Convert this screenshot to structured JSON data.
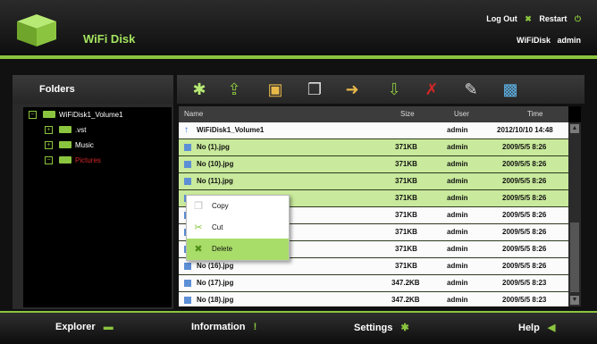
{
  "header": {
    "title": "WiFi Disk",
    "logout_label": "Log Out",
    "restart_label": "Restart",
    "device_name": "WiFiDisk",
    "user": "admin"
  },
  "folders": {
    "title": "Folders",
    "tree": [
      {
        "label": "WiFiDisk1_Volume1",
        "expander": "−"
      },
      {
        "label": ".vst",
        "expander": "+"
      },
      {
        "label": "Music",
        "expander": "+"
      },
      {
        "label": "Pictures",
        "expander": "−"
      }
    ]
  },
  "toolbar": {
    "icons": [
      "gear-icon",
      "upload-icon",
      "new-folder-icon",
      "copy-icon",
      "move-icon",
      "download-icon",
      "delete-icon",
      "rename-icon",
      "image-view-icon"
    ]
  },
  "table": {
    "headers": {
      "name": "Name",
      "size": "Size",
      "user": "User",
      "time": "Time"
    },
    "rows": [
      {
        "name": "WiFiDisk1_Volume1",
        "size": "",
        "user": "admin",
        "time": "2012/10/10 14:48"
      },
      {
        "name": "No (1).jpg",
        "size": "371KB",
        "user": "admin",
        "time": "2009/5/5 8:26"
      },
      {
        "name": "No (10).jpg",
        "size": "371KB",
        "user": "admin",
        "time": "2009/5/5 8:26"
      },
      {
        "name": "No (11).jpg",
        "size": "371KB",
        "user": "admin",
        "time": "2009/5/5 8:26"
      },
      {
        "name": "",
        "size": "371KB",
        "user": "admin",
        "time": "2009/5/5 8:26"
      },
      {
        "name": "",
        "size": "371KB",
        "user": "admin",
        "time": "2009/5/5 8:26"
      },
      {
        "name": "",
        "size": "371KB",
        "user": "admin",
        "time": "2009/5/5 8:26"
      },
      {
        "name": "",
        "size": "371KB",
        "user": "admin",
        "time": "2009/5/5 8:26"
      },
      {
        "name": "No (16).jpg",
        "size": "371KB",
        "user": "admin",
        "time": "2009/5/5 8:26"
      },
      {
        "name": "No (17).jpg",
        "size": "347.2KB",
        "user": "admin",
        "time": "2009/5/5 8:23"
      },
      {
        "name": "No (18).jpg",
        "size": "347.2KB",
        "user": "admin",
        "time": "2009/5/5 8:23"
      }
    ]
  },
  "context_menu": {
    "items": [
      {
        "label": "Copy"
      },
      {
        "label": "Cut"
      },
      {
        "label": "Delete"
      }
    ]
  },
  "nav": {
    "explorer": "Explorer",
    "information": "Information",
    "settings": "Settings",
    "help": "Help"
  },
  "colors": {
    "accent": "#8bc53f",
    "row_green": "#c9ea9c",
    "title_green": "#a4e35f"
  }
}
